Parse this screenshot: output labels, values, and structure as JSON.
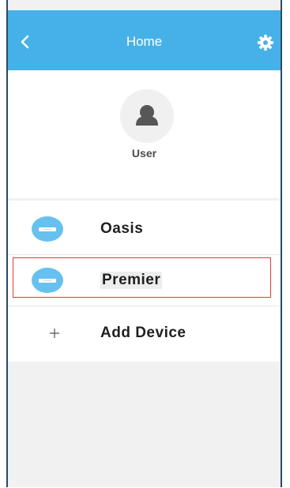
{
  "header": {
    "title": "Home",
    "back_icon": "chevron-left-icon",
    "settings_icon": "gear-icon",
    "color": "#46b1e9"
  },
  "profile": {
    "avatar_icon": "user-icon",
    "name": "User"
  },
  "devices": [
    {
      "label": "Oasis",
      "icon": "air-conditioner-icon",
      "icon_color": "#67c1ef",
      "selected": false
    },
    {
      "label": "Premier",
      "icon": "air-conditioner-icon",
      "icon_color": "#67c1ef",
      "selected": true
    }
  ],
  "add_device": {
    "label": "Add Device",
    "icon": "plus-icon"
  },
  "highlight_color": "#e03a3e"
}
